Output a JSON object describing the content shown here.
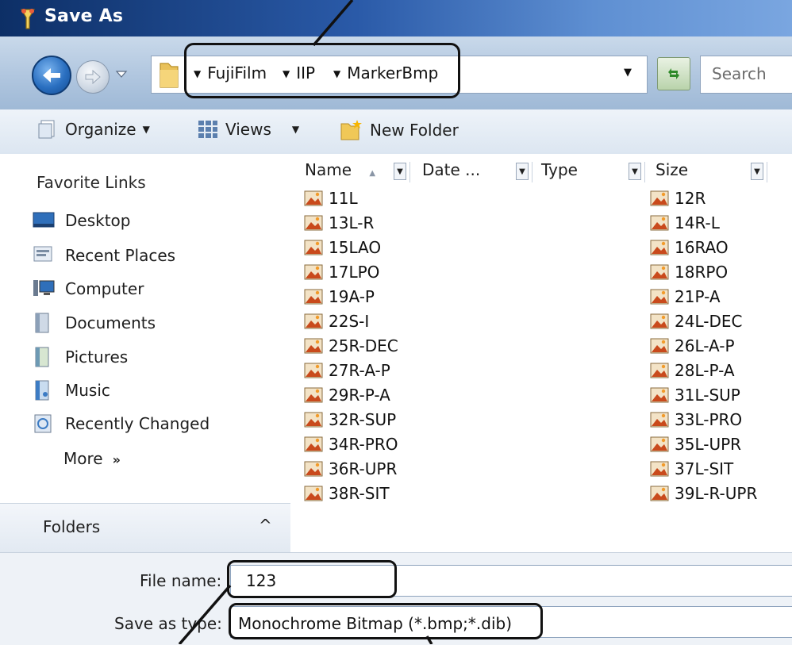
{
  "window": {
    "title": "Save As"
  },
  "address": {
    "crumbs": [
      "FujiFilm",
      "IIP",
      "MarkerBmp"
    ],
    "search_placeholder": "Search"
  },
  "toolbar": {
    "organize": "Organize",
    "views": "Views",
    "new_folder": "New Folder"
  },
  "sidebar": {
    "heading": "Favorite Links",
    "items": [
      {
        "label": "Desktop",
        "icon": "desktop-icon"
      },
      {
        "label": "Recent Places",
        "icon": "recent-places-icon"
      },
      {
        "label": "Computer",
        "icon": "computer-icon"
      },
      {
        "label": "Documents",
        "icon": "documents-icon"
      },
      {
        "label": "Pictures",
        "icon": "pictures-icon"
      },
      {
        "label": "Music",
        "icon": "music-icon"
      },
      {
        "label": "Recently Changed",
        "icon": "recently-changed-icon"
      }
    ],
    "more": "More",
    "more_chevron": "»",
    "folders": "Folders",
    "folders_chevron": "^"
  },
  "columns": [
    "Name",
    "Date ...",
    "Type",
    "Size"
  ],
  "files": {
    "left": [
      "11L",
      "13L-R",
      "15LAO",
      "17LPO",
      "19A-P",
      "22S-I",
      "25R-DEC",
      "27R-A-P",
      "29R-P-A",
      "32R-SUP",
      "34R-PRO",
      "36R-UPR",
      "38R-SIT"
    ],
    "right": [
      "12R",
      "14R-L",
      "16RAO",
      "18RPO",
      "21P-A",
      "24L-DEC",
      "26L-A-P",
      "28L-P-A",
      "31L-SUP",
      "33L-PRO",
      "35L-UPR",
      "37L-SIT",
      "39L-R-UPR"
    ]
  },
  "form": {
    "filename_label": "File name:",
    "filename_value": "123",
    "savetype_label": "Save as type:",
    "savetype_value": "Monochrome Bitmap (*.bmp;*.dib)"
  },
  "colors": {
    "titlebar": "#2a5aa8",
    "callout": "#111111"
  }
}
